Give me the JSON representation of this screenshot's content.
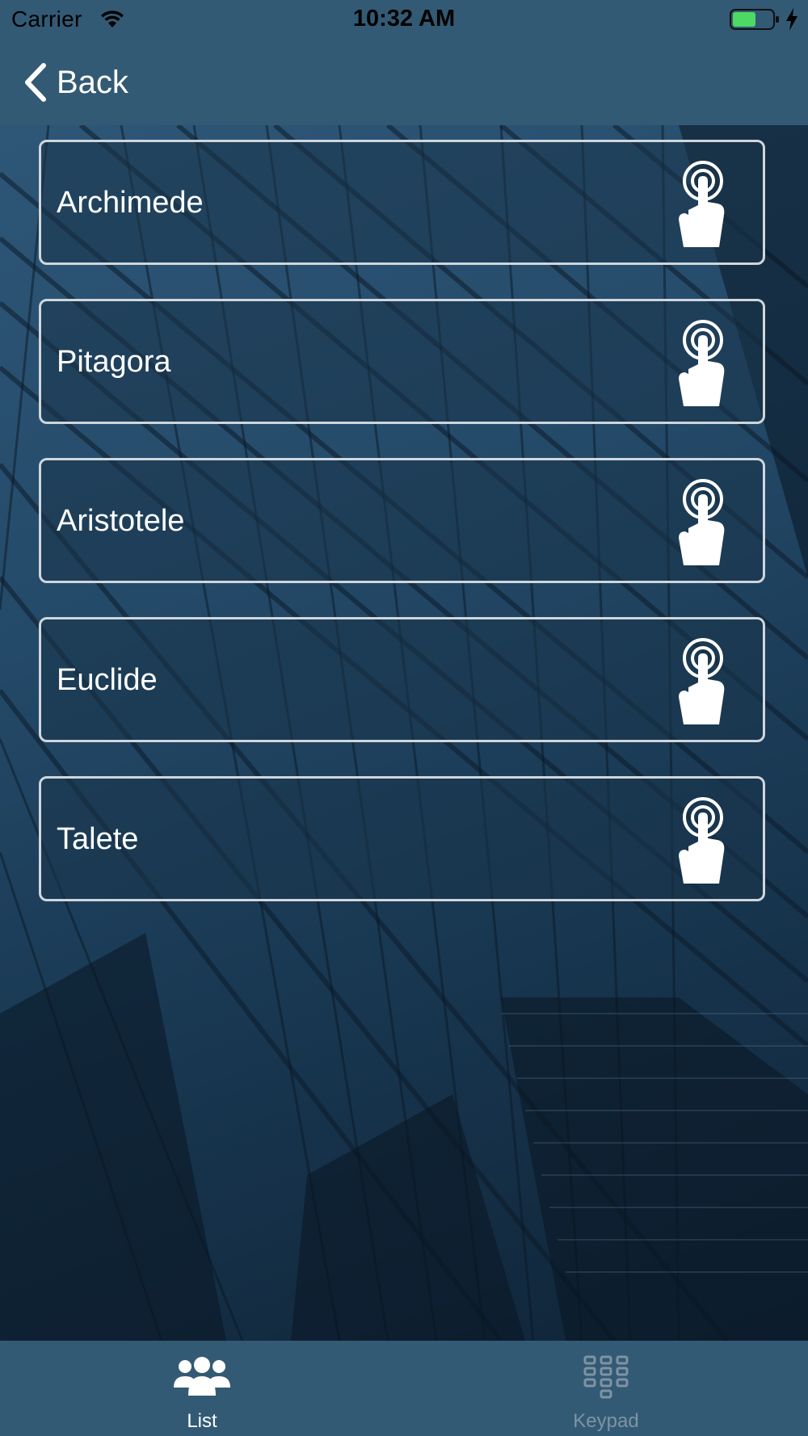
{
  "status_bar": {
    "carrier": "Carrier",
    "time": "10:32 AM",
    "wifi_icon": "wifi-icon",
    "battery_icon": "battery-icon",
    "charging_icon": "charging-bolt-icon",
    "battery_color": "#4cd964"
  },
  "nav": {
    "back_label": "Back",
    "back_icon": "chevron-left-icon"
  },
  "list": {
    "items": [
      {
        "label": "Archimede",
        "icon": "tap-hand-icon"
      },
      {
        "label": "Pitagora",
        "icon": "tap-hand-icon"
      },
      {
        "label": "Aristotele",
        "icon": "tap-hand-icon"
      },
      {
        "label": "Euclide",
        "icon": "tap-hand-icon"
      },
      {
        "label": "Talete",
        "icon": "tap-hand-icon"
      }
    ]
  },
  "tab_bar": {
    "tabs": [
      {
        "label": "List",
        "icon": "people-group-icon",
        "active": true
      },
      {
        "label": "Keypad",
        "icon": "keypad-icon",
        "active": false
      }
    ]
  },
  "colors": {
    "bar_background": "#335a74",
    "item_border": "#cfd6dc",
    "active_tab": "#ffffff",
    "inactive_tab": "#7e93a4"
  }
}
